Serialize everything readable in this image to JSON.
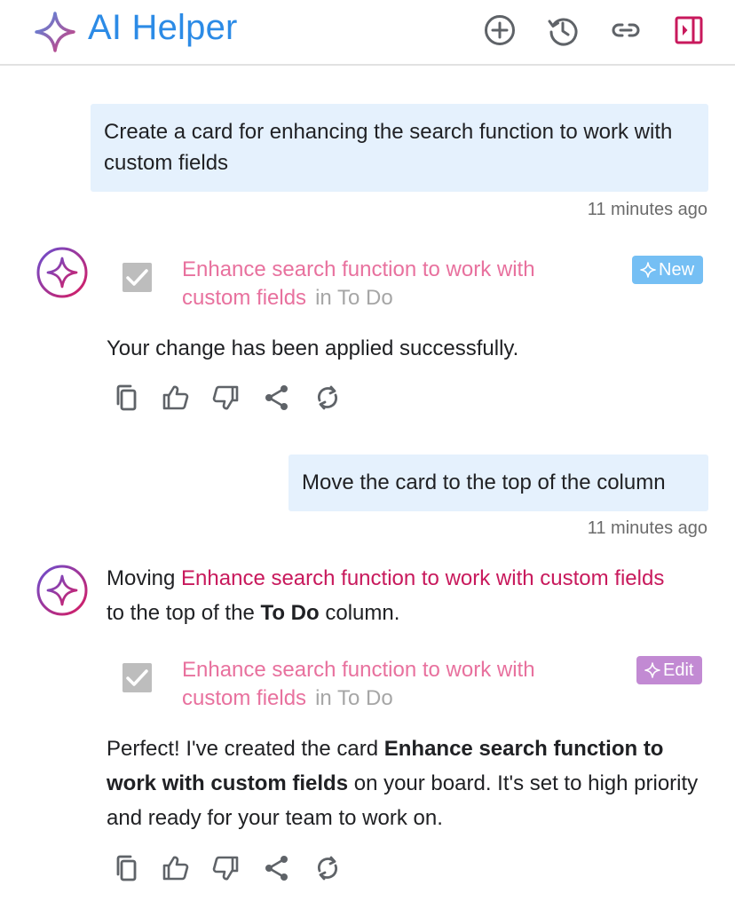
{
  "header": {
    "title": "AI Helper",
    "icons": [
      "sparkle-logo",
      "add-circle-icon",
      "history-icon",
      "link-icon",
      "sidebar-close-icon"
    ]
  },
  "colors": {
    "accent": "#2c8be6",
    "highlight": "#c8195c",
    "card_title": "#e8719e",
    "bubble": "#e5f1fd",
    "badge_new": "#75bff4",
    "badge_edit": "#c28ad3",
    "brand_icon": "#c8195c"
  },
  "conversation": {
    "user_message_1": {
      "text": "Create a card for enhancing the search function to work with custom fields",
      "time": "11 minutes ago"
    },
    "assistant_1": {
      "card": {
        "title": "Enhance search function to work with custom fields",
        "column": "in To Do",
        "badge": "New"
      },
      "text": "Your change has been applied successfully."
    },
    "user_message_2": {
      "text": "Move the card to the top of the column",
      "time": "11 minutes ago"
    },
    "assistant_2": {
      "intro": {
        "prefix": "Moving ",
        "card": "Enhance search function to work with custom fields",
        "middle": " to the top of the ",
        "column": "To Do",
        "suffix": " column."
      },
      "card": {
        "title": "Enhance search function to work with custom fields",
        "column": "in To Do",
        "badge": "Edit"
      },
      "result": {
        "prefix": "Perfect! I've created the card ",
        "card": "Enhance search function to work with custom fields",
        "suffix": " on your board. It's set to high priority and ready for your team to work on."
      }
    }
  },
  "action_icons": [
    "copy-icon",
    "thumbs-up-icon",
    "thumbs-down-icon",
    "share-icon",
    "regenerate-icon"
  ]
}
